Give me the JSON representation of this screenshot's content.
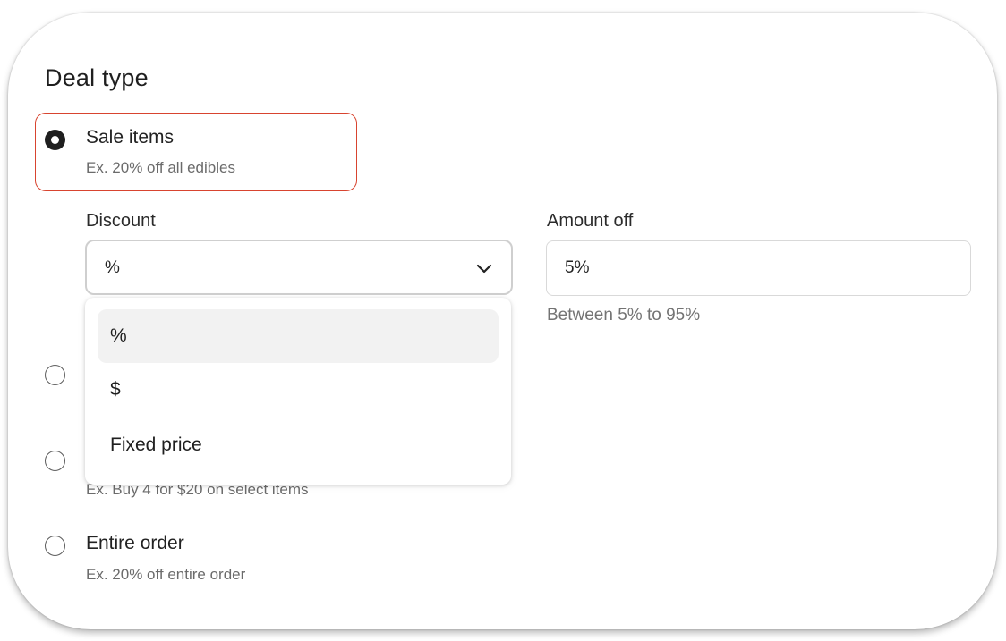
{
  "title": "Deal type",
  "options": [
    {
      "label": "Sale items",
      "sub": "Ex. 20% off all edibles",
      "checked": true
    },
    {
      "label": "",
      "sub": "",
      "checked": false
    },
    {
      "label": "",
      "sub": "Ex. Buy 4 for $20 on select items",
      "checked": false
    },
    {
      "label": "Entire order",
      "sub": "Ex. 20% off entire order",
      "checked": false
    }
  ],
  "discount": {
    "label": "Discount",
    "value": "%",
    "options": [
      "%",
      "$",
      "Fixed price"
    ]
  },
  "amount_off": {
    "label": "Amount off",
    "value": "5%",
    "hint": "Between 5% to 95%"
  },
  "colors": {
    "highlight": "#d8442f",
    "text": "#1f1f1f",
    "muted": "#6b6b6b"
  }
}
